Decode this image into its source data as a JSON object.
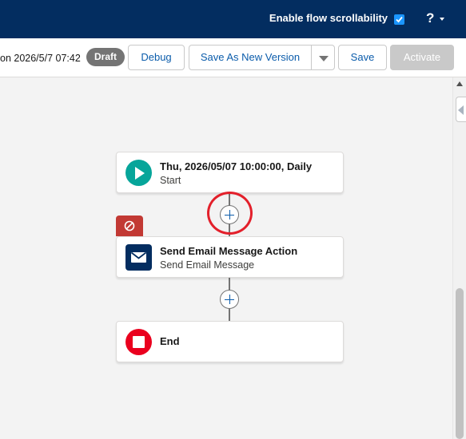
{
  "header": {
    "scroll_label": "Enable flow scrollability",
    "scroll_checked": true,
    "help_label": "?"
  },
  "toolbar": {
    "saved_text": "on 2026/5/7 07:42",
    "status_badge": "Draft",
    "debug_label": "Debug",
    "save_as_new_label": "Save As New Version",
    "save_label": "Save",
    "activate_label": "Activate"
  },
  "flow": {
    "start": {
      "title": "Thu, 2026/05/07 10:00:00, Daily",
      "subtitle": "Start",
      "icon": "play-icon",
      "color": "#06a59a"
    },
    "action": {
      "title": "Send Email Message Action",
      "subtitle": "Send Email Message",
      "icon": "email-icon",
      "color": "#032d60"
    },
    "end": {
      "title": "End",
      "icon": "stop-icon",
      "color": "#ea001e"
    },
    "fault_icon": "prohibit-icon",
    "add_icon": "plus-icon"
  },
  "colors": {
    "header_bg": "#032d60",
    "highlight": "#e3202b",
    "brand_blue": "#0b5cab"
  }
}
